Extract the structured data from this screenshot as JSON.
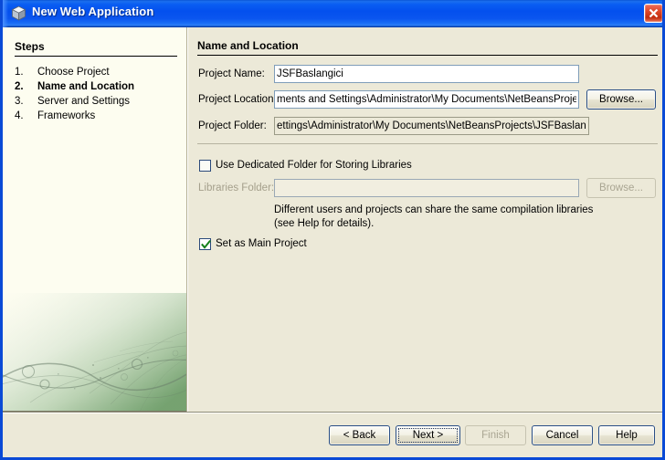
{
  "window": {
    "title": "New Web Application",
    "icon": "cube-icon",
    "close_label": "×",
    "accent_blue": "#0a4ad6",
    "dialog_bg": "#ece9d8",
    "steps_bg": "#fdfdf0"
  },
  "steps_panel": {
    "heading": "Steps",
    "items": [
      {
        "number": "1.",
        "label": "Choose Project",
        "current": false
      },
      {
        "number": "2.",
        "label": "Name and Location",
        "current": true
      },
      {
        "number": "3.",
        "label": "Server and Settings",
        "current": false
      },
      {
        "number": "4.",
        "label": "Frameworks",
        "current": false
      }
    ]
  },
  "content": {
    "heading": "Name and Location",
    "fields": {
      "project_name": {
        "label": "Project Name:",
        "value": "JSFBaslangici",
        "placeholder": ""
      },
      "project_location": {
        "label": "Project Location:",
        "value": "ments and Settings\\Administrator\\My Documents\\NetBeansProjects",
        "browse_label": "Browse..."
      },
      "project_folder": {
        "label": "Project Folder:",
        "value": "ettings\\Administrator\\My Documents\\NetBeansProjects\\JSFBaslangici",
        "readonly": true
      },
      "libraries_folder": {
        "label": "Libraries Folder:",
        "value": "",
        "placeholder": "",
        "browse_label": "Browse...",
        "disabled": true
      }
    },
    "checkboxes": {
      "dedicated_folder": {
        "label": "Use Dedicated Folder for Storing Libraries",
        "checked": false
      },
      "main_project": {
        "label": "Set as Main Project",
        "checked": true
      }
    },
    "help_lines": [
      "Different users and projects can share the same compilation libraries",
      "(see Help for details)."
    ]
  },
  "buttons": {
    "back": {
      "label": "< Back",
      "disabled": false,
      "focused": false
    },
    "next": {
      "label": "Next >",
      "disabled": false,
      "focused": true
    },
    "finish": {
      "label": "Finish",
      "disabled": true,
      "focused": false
    },
    "cancel": {
      "label": "Cancel",
      "disabled": false,
      "focused": false
    },
    "help": {
      "label": "Help",
      "disabled": false,
      "focused": false
    }
  }
}
